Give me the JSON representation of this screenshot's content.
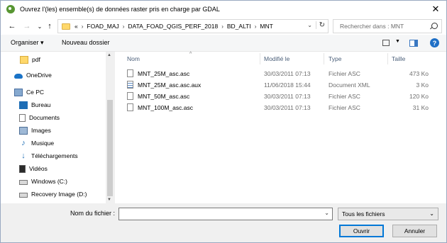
{
  "window": {
    "title": "Ouvrez l'(les) ensemble(s) de données raster pris en charge par GDAL",
    "close_glyph": "✕"
  },
  "nav": {
    "back": "←",
    "forward": "→",
    "recent": "⌄",
    "up": "↑",
    "breadcrumb": [
      "«",
      "FOAD_MAJ",
      "DATA_FOAD_QGIS_PERF_2018",
      "BD_ALTI",
      "MNT"
    ],
    "search_placeholder": "Rechercher dans : MNT"
  },
  "toolbar": {
    "organize": "Organiser ▾",
    "new_folder": "Nouveau dossier"
  },
  "sidebar": {
    "items": [
      {
        "label": "pdf",
        "icon": "folder-icon"
      },
      {
        "label": "OneDrive",
        "icon": "cloud-icon"
      },
      {
        "label": "Ce PC",
        "icon": "computer-icon"
      },
      {
        "label": "Bureau",
        "icon": "desktop-icon"
      },
      {
        "label": "Documents",
        "icon": "documents-icon"
      },
      {
        "label": "Images",
        "icon": "images-icon"
      },
      {
        "label": "Musique",
        "icon": "music-icon"
      },
      {
        "label": "Téléchargements",
        "icon": "downloads-icon"
      },
      {
        "label": "Vidéos",
        "icon": "videos-icon"
      },
      {
        "label": "Windows (C:)",
        "icon": "drive-icon"
      },
      {
        "label": "Recovery Image (D:)",
        "icon": "drive-icon"
      }
    ]
  },
  "files": {
    "columns": [
      "Nom",
      "Modifié le",
      "Type",
      "Taille"
    ],
    "rows": [
      {
        "name": "MNT_25M_asc.asc",
        "date": "30/03/2011 07:13",
        "type": "Fichier ASC",
        "size": "473 Ko",
        "icon": "file-icon"
      },
      {
        "name": "MNT_25M_asc.asc.aux",
        "date": "11/06/2018 15:44",
        "type": "Document XML",
        "size": "3 Ko",
        "icon": "xml-file-icon"
      },
      {
        "name": "MNT_50M_asc.asc",
        "date": "30/03/2011 07:13",
        "type": "Fichier ASC",
        "size": "120 Ko",
        "icon": "file-icon"
      },
      {
        "name": "MNT_100M_asc.asc",
        "date": "30/03/2011 07:13",
        "type": "Fichier ASC",
        "size": "31 Ko",
        "icon": "file-icon"
      }
    ]
  },
  "footer": {
    "filename_label": "Nom du fichier :",
    "filename_value": "",
    "filetype_value": "Tous les fichiers",
    "open_label": "Ouvrir",
    "cancel_label": "Annuler"
  },
  "colors": {
    "accent": "#0078d7",
    "folder": "#ffd86b",
    "qgis_green": "#589632"
  }
}
